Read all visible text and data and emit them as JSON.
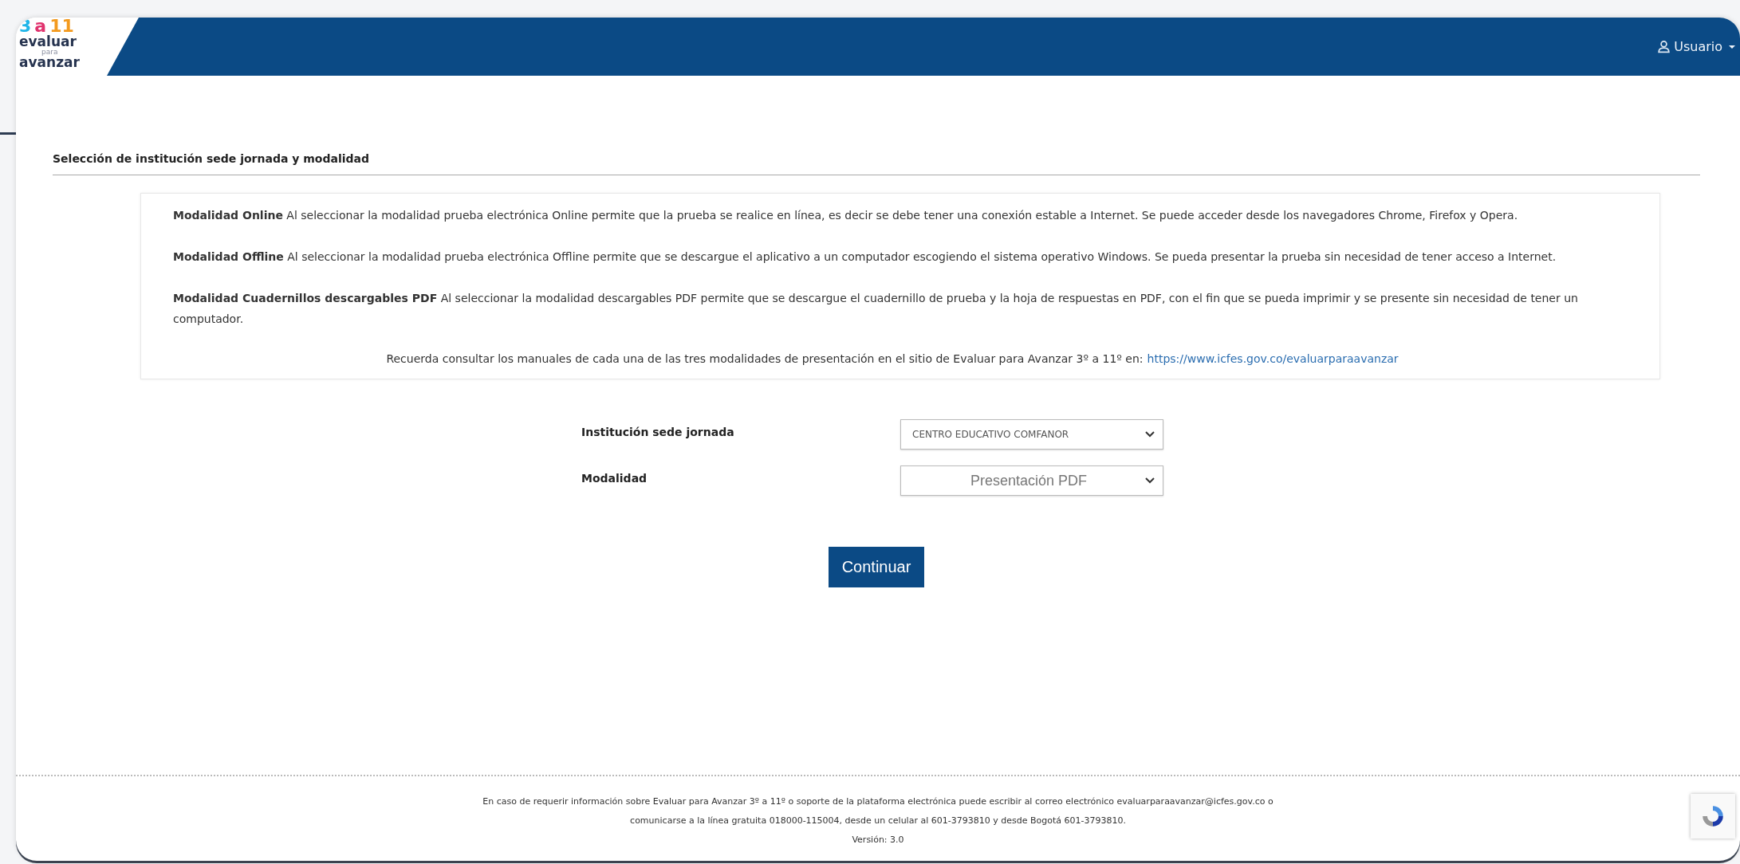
{
  "logo": {
    "grades": [
      "3",
      "a",
      "11"
    ],
    "top": "evaluar",
    "middle": "para",
    "bottom": "avanzar"
  },
  "user_menu": {
    "label": "Usuario"
  },
  "section_title": "Selección de institución sede jornada y modalidad",
  "info": {
    "paragraphs": [
      "**Modalidad Online** Al seleccionar la modalidad prueba electrónica Online permite que la prueba se realice en línea, es decir se debe tener una conexión estable a Internet. Se puede acceder desde los navegadores Chrome, Firefox y Opera.",
      "**Modalidad Offline** Al seleccionar la modalidad prueba electrónica Offline permite que se descargue el aplicativo a un computador escogiendo el sistema operativo Windows. Se pueda presentar la prueba sin necesidad de tener acceso a Internet.",
      "**Modalidad Cuadernillos descargables PDF** Al seleccionar la modalidad descargables PDF permite que se descargue el cuadernillo de prueba y la hoja de respuestas en PDF, con el fin que se pueda imprimir y se presente sin necesidad de tener un computador."
    ],
    "reminder": "Recuerda consultar los manuales de cada una de las tres modalidades de presentación en el sitio de Evaluar para Avanzar 3º a 11º en:",
    "link": "https://www.icfes.gov.co/evaluarparaavanzar"
  },
  "form": [
    {
      "label": "Institución sede jornada",
      "value": "CENTRO EDUCATIVO COMFANOR",
      "kind": "small"
    },
    {
      "label": "Modalidad",
      "value": "Presentación PDF",
      "kind": "large"
    }
  ],
  "submit": "Continuar",
  "footer": [
    "En caso de requerir información sobre Evaluar para Avanzar 3º a 11º o soporte de la plataforma electrónica puede escribir al correo electrónico evaluarparaavanzar@icfes.gov.co o",
    "comunicarse a la línea gratuita 018000-115004, desde un celular al 601-3793810 y desde Bogotá 601-3793810.",
    "Versión: 3.0"
  ]
}
